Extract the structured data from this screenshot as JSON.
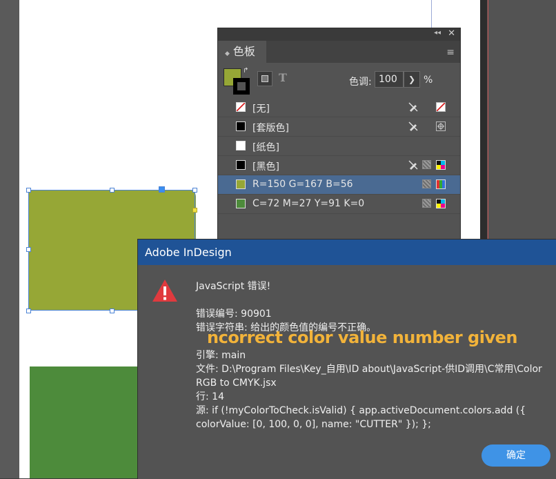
{
  "swatches_panel": {
    "tab_label": "色板",
    "tint_label": "色调:",
    "tint_value": "100",
    "tint_unit": "%",
    "swatches": [
      {
        "name": "[无]",
        "color": "#ffffff",
        "icon": "none",
        "type_icon": "none-icon",
        "selected": false
      },
      {
        "name": "[套版色]",
        "color": "#000000",
        "icon": "registration",
        "type_icon": "registration-icon",
        "selected": false
      },
      {
        "name": "[纸色]",
        "color": "#ffffff",
        "icon": "paper",
        "type_icon": "",
        "selected": false
      },
      {
        "name": "[黑色]",
        "color": "#000000",
        "icon": "black",
        "type_icon": "cmyk-icon",
        "selected": false
      },
      {
        "name": "R=150 G=167 B=56",
        "color": "#96a736",
        "icon": "rgb",
        "type_icon": "rgb-icon",
        "selected": true
      },
      {
        "name": "C=72 M=27 Y=91 K=0",
        "color": "#4d8b3b",
        "icon": "cmyk",
        "type_icon": "cmyk-icon",
        "selected": false
      }
    ]
  },
  "dialog": {
    "title": "Adobe InDesign",
    "line_heading": "JavaScript 错误!",
    "line_error_number": "错误编号: 90901",
    "line_error_string": "错误字符串: 给出的颜色值的编号不正确。",
    "line_engine": "引擎: main",
    "line_file": "文件: D:\\Program Files\\Key_自用\\ID about\\JavaScript-供ID调用\\C常用\\Color RGB to CMYK.jsx",
    "line_line": "行: 14",
    "line_source": "源: if (!myColorToCheck.isValid) { app.activeDocument.colors.add ({ colorValue: [0, 100, 0, 0], name: \"CUTTER\" }); };",
    "ok_label": "确定"
  },
  "overlay_caption": "ncorrect color value number given",
  "colors": {
    "dialog_title_bar": "#1f5396",
    "ok_button": "#3f93e6",
    "caption": "#f2b33a",
    "olive_shape": "#96a736",
    "green_shape": "#4d8b3b",
    "selection": "#4a6a92"
  }
}
